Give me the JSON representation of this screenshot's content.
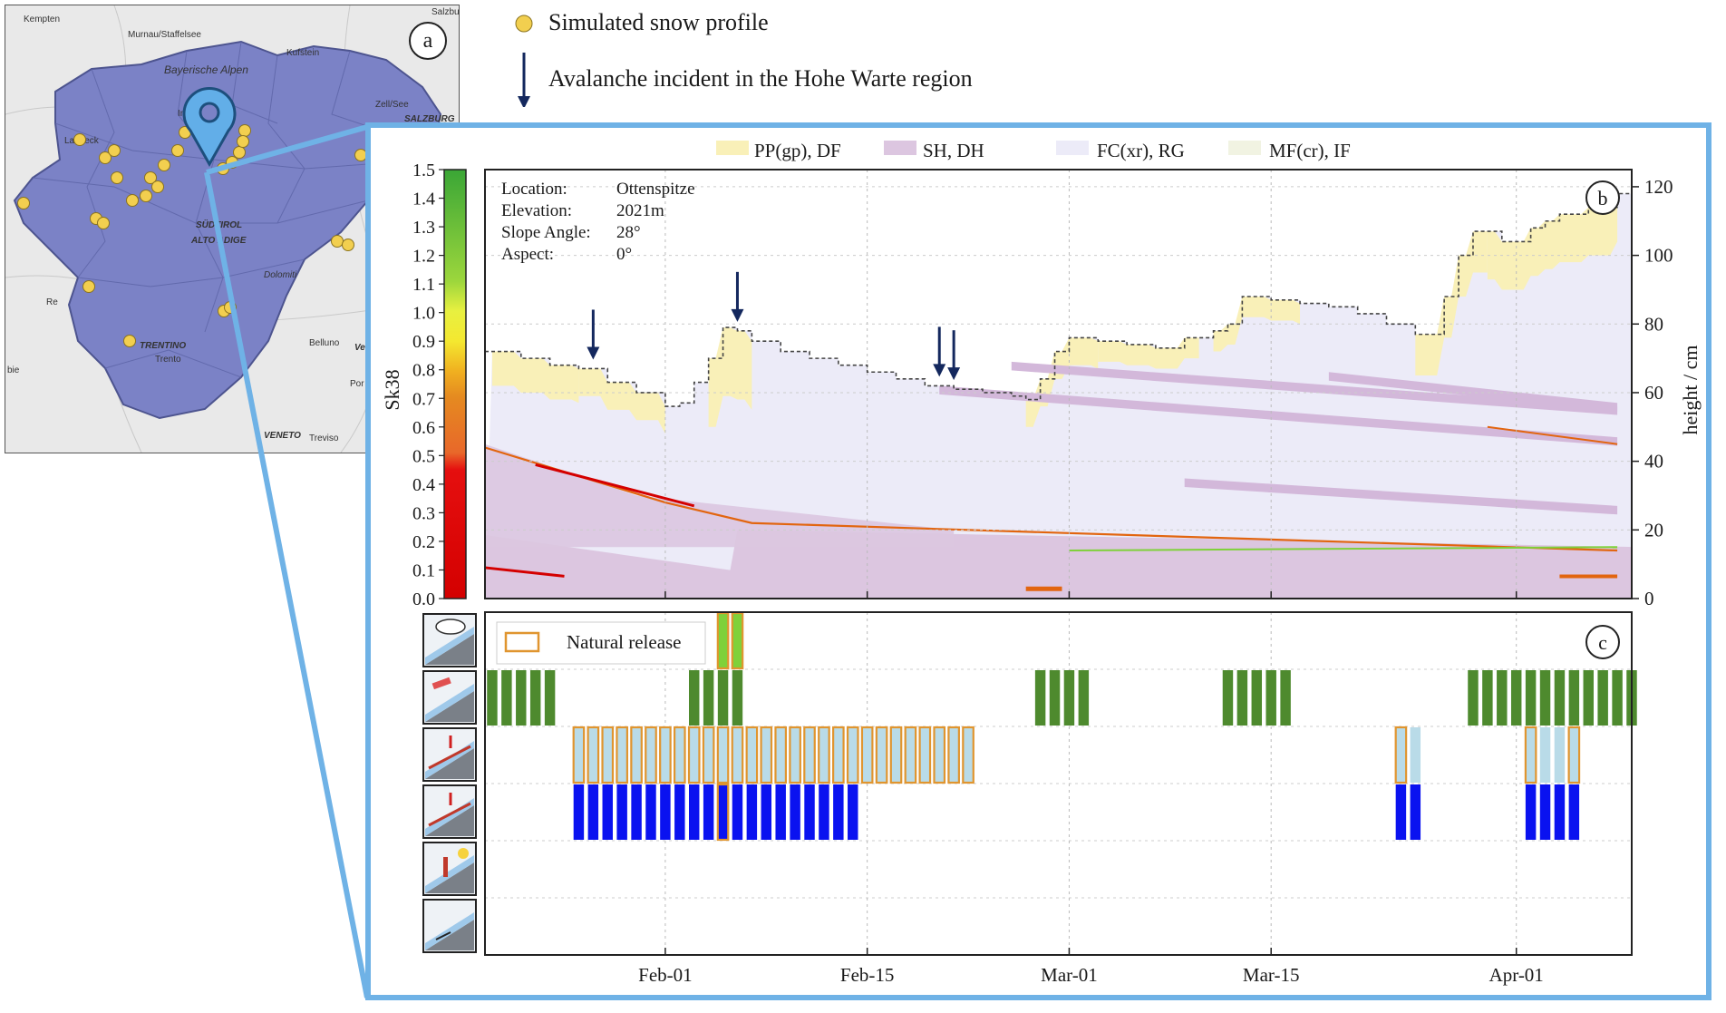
{
  "panel_a": {
    "letter": "a",
    "map_labels": [
      "Kempten",
      "Murnau/Staffelsee",
      "Bayerische Alpen",
      "Kufstein",
      "Salzburg",
      "Zell/See",
      "SALZBURG",
      "Landeck",
      "Inn",
      "SÜDTIROL",
      "ALTO ADIGE",
      "Dolomiti",
      "TRENTINO",
      "Trento",
      "Belluno",
      "VENETO",
      "Treviso",
      "Ve",
      "Por",
      "Re",
      "bie"
    ]
  },
  "top_legend": {
    "marker_label": "Simulated snow profile",
    "arrow_label": "Avalanche incident in the Hohe Warte region",
    "marker_color": "#f2cf4f",
    "arrow_color": "#14285e"
  },
  "panel_b": {
    "letter": "b",
    "legend": [
      {
        "label": "PP(gp), DF",
        "color": "#f9f0b8"
      },
      {
        "label": "SH, DH",
        "color": "#dcc6e0"
      },
      {
        "label": "FC(xr), RG",
        "color": "#ecebf8"
      },
      {
        "label": "MF(cr), IF",
        "color": "#f1f3e2"
      }
    ],
    "info": [
      {
        "k": "Location:",
        "v": "Ottenspitze"
      },
      {
        "k": "Elevation:",
        "v": "2021m"
      },
      {
        "k": "Slope Angle:",
        "v": "28°"
      },
      {
        "k": "Aspect:",
        "v": "0°"
      }
    ],
    "colorbar_label": "Sk38",
    "colorbar_ticks": [
      "1.5",
      "1.4",
      "1.3",
      "1.2",
      "1.1",
      "1.0",
      "0.9",
      "0.8",
      "0.7",
      "0.6",
      "0.5",
      "0.4",
      "0.3",
      "0.2",
      "0.1",
      "0.0"
    ],
    "right_axis_label": "height / cm",
    "right_ticks": [
      "120",
      "100",
      "80",
      "60",
      "40",
      "20",
      "0"
    ]
  },
  "panel_c": {
    "letter": "c",
    "legend_label": "Natural release",
    "colors": {
      "green": "#4e8a2e",
      "lightblue": "#b9dbe8",
      "blue": "#0a12f0",
      "orange": "#e0952f",
      "lime": "#7fd13a"
    },
    "x_ticks": [
      "Feb-01",
      "Feb-15",
      "Mar-01",
      "Mar-15",
      "Apr-01"
    ],
    "icon_rows": [
      "new-snow-icon",
      "wind-drifted-snow-icon",
      "persistent-weak-layer-icon",
      "deep-persistent-weak-layer-icon",
      "wet-snow-icon",
      "gliding-snow-icon"
    ]
  },
  "chart_data": {
    "type": "bar",
    "title": "",
    "x_ticks": [
      "Feb-01",
      "Feb-15",
      "Mar-01",
      "Mar-15",
      "Apr-01"
    ],
    "avalanche_incidents_days": [
      -5,
      5,
      19,
      20
    ],
    "snow_height_profile": {
      "ylabel": "height / cm",
      "ylim": [
        0,
        125
      ],
      "day_offsets_from_feb01": [
        -12,
        -10,
        -8,
        -6,
        -4,
        -2,
        0,
        1,
        2,
        3,
        4,
        5,
        6,
        8,
        10,
        12,
        14,
        16,
        18,
        20,
        22,
        24,
        25,
        26,
        27,
        28,
        30,
        32,
        34,
        36,
        38,
        39,
        40,
        42,
        44,
        46,
        48,
        50,
        52,
        54,
        55,
        56,
        58,
        60,
        61,
        62,
        64,
        66
      ],
      "heights_cm": [
        72,
        70,
        68,
        67,
        63,
        60,
        56,
        57,
        63,
        70,
        79,
        78,
        75,
        72,
        70,
        68,
        66,
        64,
        62,
        61,
        60,
        59,
        58,
        64,
        72,
        76,
        75,
        74,
        73,
        76,
        78,
        80,
        88,
        87,
        86,
        85,
        83,
        80,
        77,
        88,
        100,
        107,
        104,
        108,
        110,
        112,
        114,
        118
      ]
    }
  }
}
